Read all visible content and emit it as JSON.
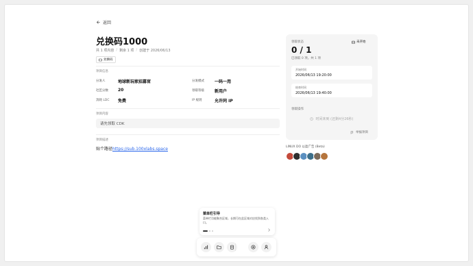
{
  "nav": {
    "back_label": "返回"
  },
  "header": {
    "title": "兑换码1000",
    "meta_total": "共 1 项内容",
    "meta_remaining": "剩余 1 项",
    "meta_created": "创建于 2026/06/13",
    "tag_label": "兑换码"
  },
  "info": {
    "section_label": "项目信息",
    "distributor_label": "分发人",
    "distributor_value": "地球新玩家招募官",
    "mode_label": "分发模式",
    "mode_value": "一码一用",
    "social_label": "社区分数",
    "social_value": "20",
    "threshold_label": "领取等级",
    "threshold_value": "新用户",
    "cost_label": "消耗 LDC",
    "cost_value": "免费",
    "ip_label": "IP 规则",
    "ip_value": "允许同 IP"
  },
  "content": {
    "section_label": "项目内容",
    "cdk_placeholder": "请先领取 CDK"
  },
  "description": {
    "section_label": "项目描述",
    "text_prefix": "贴个路径",
    "link_text": "https://sub.100xlabs.space"
  },
  "status_card": {
    "label": "领取状态",
    "status_badge": "未开始",
    "count": "0 / 1",
    "sub": "已领取 0 项，共 1 项",
    "start_label": "开始时间",
    "start_value": "2026/06/13 19:20:00",
    "end_label": "结束时间",
    "end_value": "2026/06/13 19:40:00",
    "action_label": "领取操作",
    "claim_button": "时间未到 (还剩4分26秒)",
    "report_label": "举报项目"
  },
  "ads": {
    "label": "LINUX DO 以盈广告 (Beta)",
    "avatar_colors": [
      "#c44a3b",
      "#2f2f2f",
      "#5a8fc0",
      "#3d6f8a",
      "#7c6a5a",
      "#b5753d"
    ]
  },
  "guide": {
    "title": "菜单栏引导",
    "description": "菜单栏功能聚合区域，长期可在此区域对应找到各类入口。",
    "step": "1 / 3"
  },
  "dock": {
    "items": [
      "chart-icon",
      "folder-icon",
      "clipboard-icon",
      "plus-circle-icon",
      "user-icon"
    ]
  },
  "colors": {
    "link": "#2563eb",
    "card_bg": "#f5f5f5"
  }
}
